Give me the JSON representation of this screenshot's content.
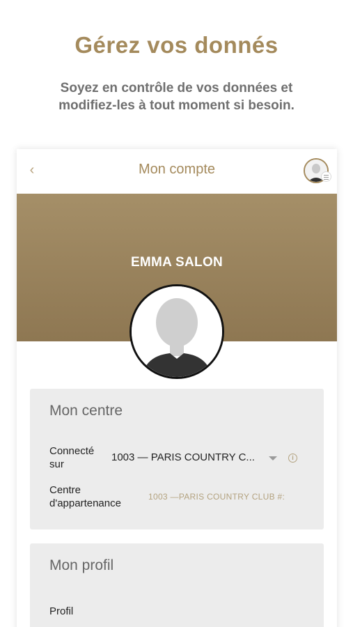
{
  "promo": {
    "headline": "Gérez vos donnés",
    "subtitle_line1": "Soyez en contrôle de vos données et",
    "subtitle_line2": "modifiez-les à tout moment si besoin."
  },
  "appbar": {
    "back_icon": "chevron-left-icon",
    "back_glyph": "‹",
    "title": "Mon compte"
  },
  "banner": {
    "user_name": "EMMA SALON"
  },
  "centre_card": {
    "title": "Mon centre",
    "connected_label_line1": "Connecté",
    "connected_label_line2": "sur",
    "connected_value": "1003 — PARIS COUNTRY C...",
    "membership_label_line1": "Centre",
    "membership_label_line2": "d'appartenance",
    "membership_value": "1003 —PARIS COUNTRY CLUB #:"
  },
  "profile_card": {
    "title": "Mon profil",
    "profile_label": "Profil"
  },
  "colors": {
    "brand_gold": "#a48a5c",
    "banner_top": "#a58f68",
    "banner_bottom": "#8e7752",
    "card_bg": "#ececec"
  }
}
